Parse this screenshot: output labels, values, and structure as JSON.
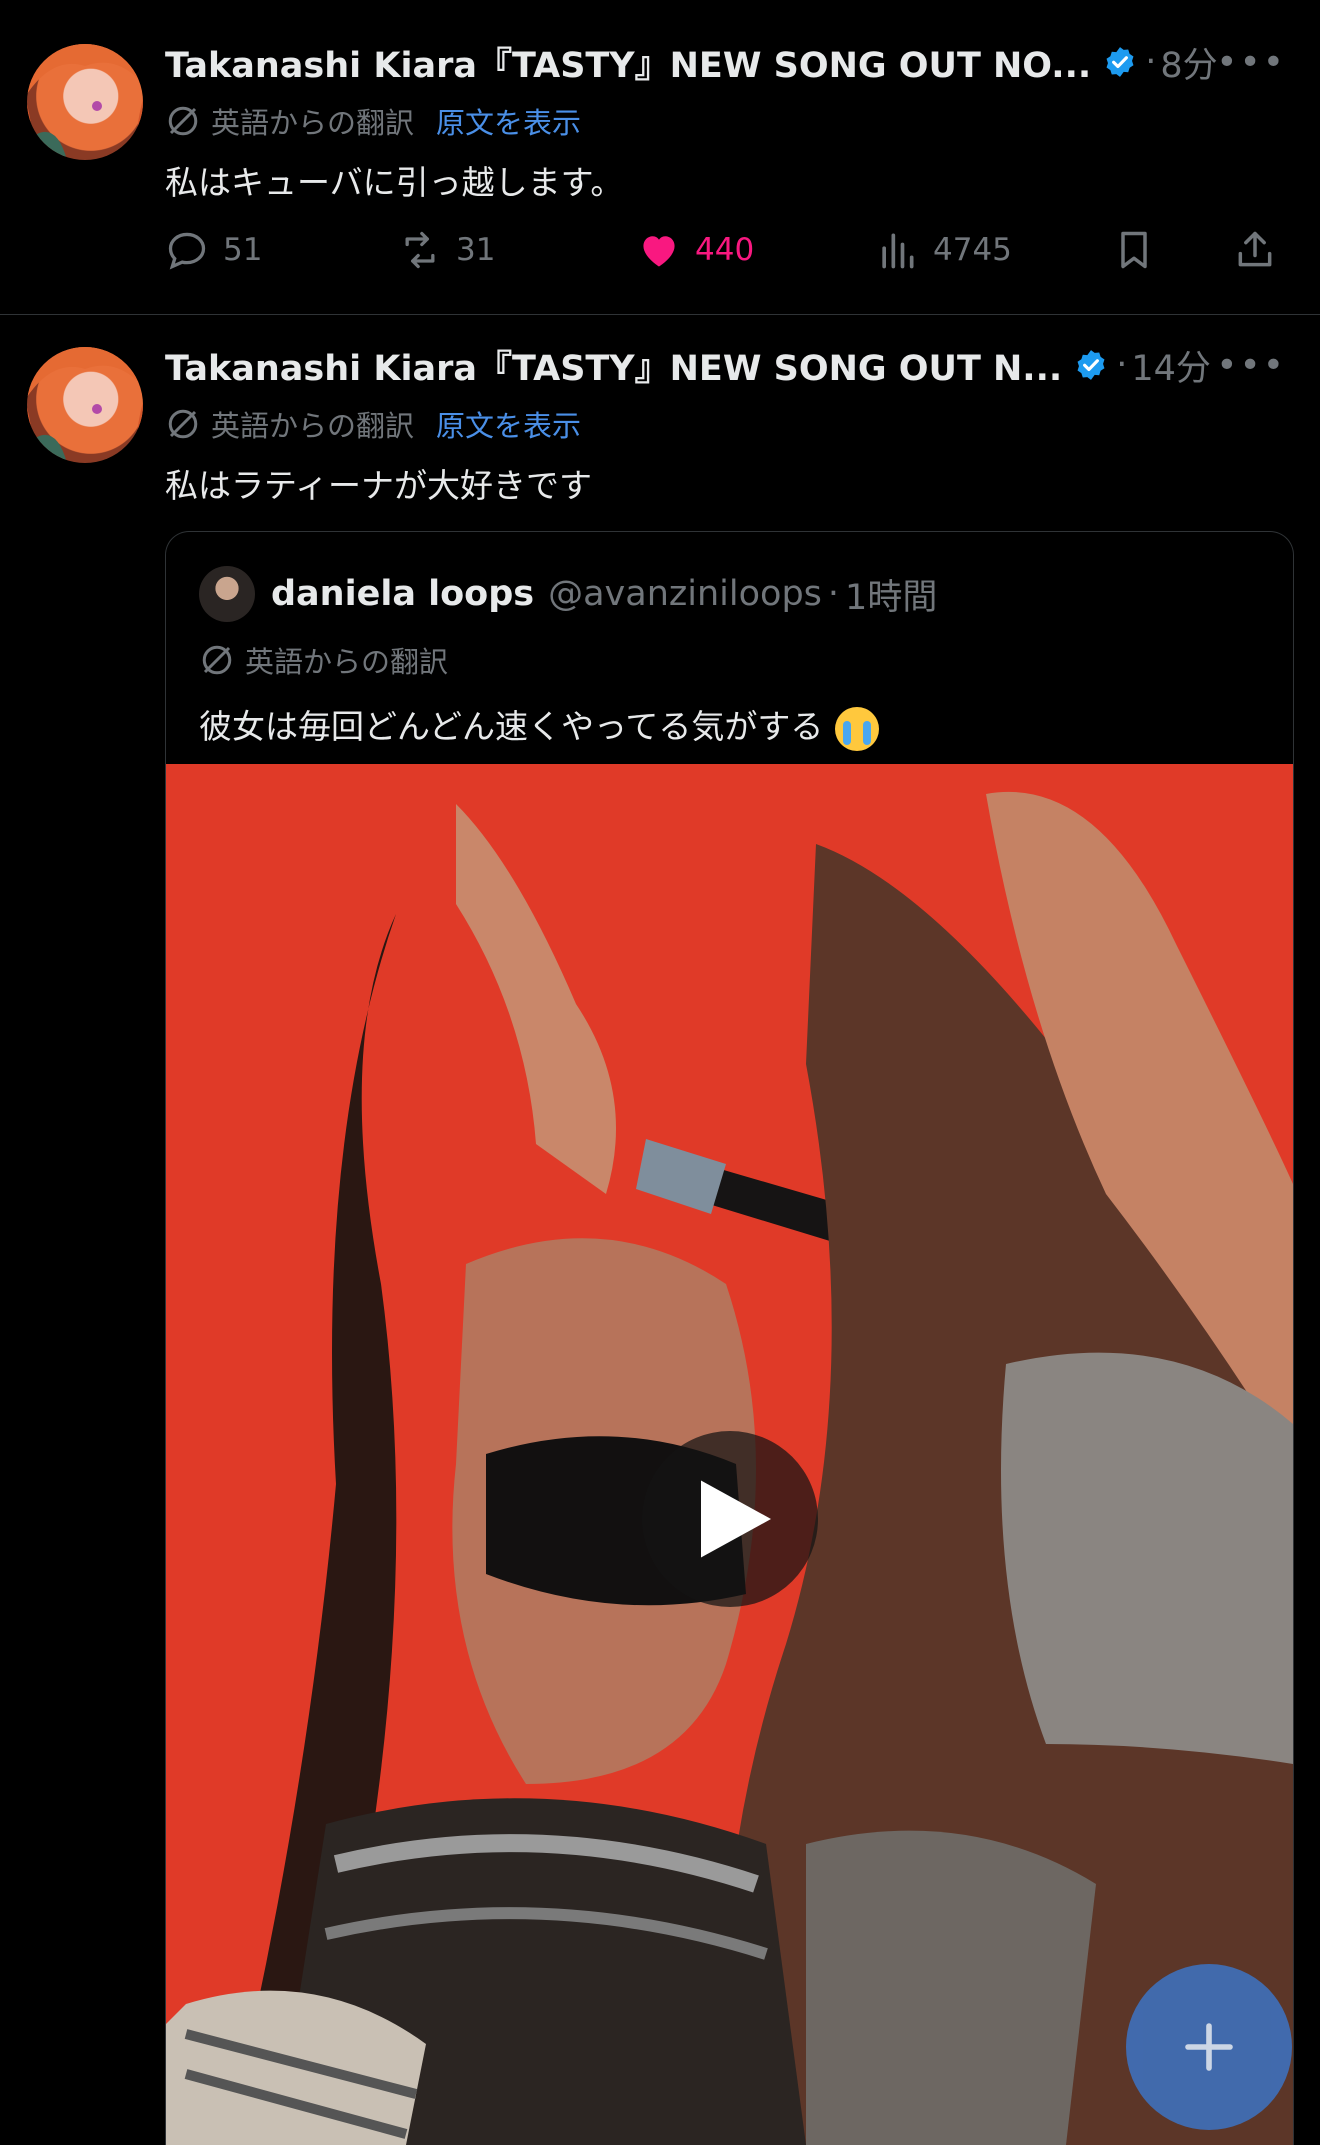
{
  "posts": [
    {
      "author": "Takanashi Kiara『TASTY』NEW SONG OUT NO...",
      "time": "8分",
      "translation_label": "英語からの翻訳",
      "show_original": "原文を表示",
      "text": "私はキューバに引っ越します。",
      "stats": {
        "replies": "51",
        "reposts": "31",
        "likes": "440",
        "views": "4745"
      }
    },
    {
      "author": "Takanashi Kiara『TASTY』NEW SONG OUT N...",
      "time": "14分",
      "translation_label": "英語からの翻訳",
      "show_original": "原文を表示",
      "text": "私はラティーナが大好きです",
      "quote": {
        "name": "daniela loops",
        "handle": "@avanziniloops",
        "time": "1時間",
        "translation_label": "英語からの翻訳",
        "text": "彼女は毎回どんどん速くやってる気がする"
      }
    }
  ],
  "colors": {
    "background": "#000000",
    "text": "#e7e9ea",
    "muted": "#71767b",
    "link": "#4a8fe7",
    "like": "#f91880",
    "verified": "#1d9bf0",
    "video_bg": "#e03a28"
  },
  "icons": [
    "verified-icon",
    "more-icon",
    "translate-icon",
    "reply-icon",
    "repost-icon",
    "like-icon",
    "views-icon",
    "bookmark-icon",
    "share-icon",
    "play-icon",
    "plus-icon",
    "loudly-crying-emoji"
  ]
}
